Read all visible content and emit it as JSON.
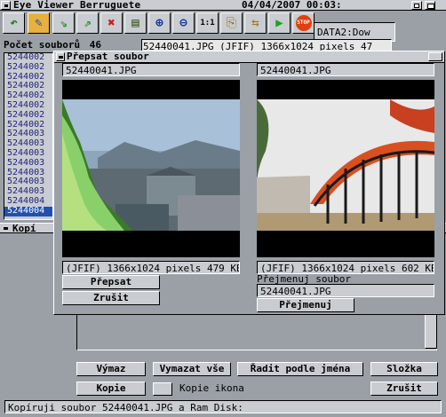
{
  "window": {
    "title": "Eye Viewer Berruguete",
    "datetime": "04/04/2007 00:03:"
  },
  "toolbar": {
    "buttons": [
      {
        "name": "back-icon",
        "glyph": "↶"
      },
      {
        "name": "image-edit-icon",
        "glyph": "✎"
      },
      {
        "name": "arrow-down-icon",
        "glyph": "⇘"
      },
      {
        "name": "arrow-right-icon",
        "glyph": "⇗"
      },
      {
        "name": "delete-icon",
        "glyph": "✖"
      },
      {
        "name": "info-icon",
        "glyph": "▤"
      },
      {
        "name": "zoom-in-icon",
        "glyph": "⊕"
      },
      {
        "name": "zoom-out-icon",
        "glyph": "⊖"
      },
      {
        "name": "actual-size-icon",
        "glyph": "1:1"
      },
      {
        "name": "copy-icon",
        "glyph": "⎘"
      },
      {
        "name": "move-icon",
        "glyph": "⇆"
      },
      {
        "name": "play-icon",
        "glyph": "▶"
      },
      {
        "name": "stop-icon",
        "glyph": "STOP"
      }
    ],
    "drive_field": "DATA2:Dow"
  },
  "left_panel": {
    "count_label": "Počet souborů",
    "count_value": "46",
    "files": [
      "5244002",
      "5244002",
      "5244002",
      "5244002",
      "5244002",
      "5244002",
      "5244002",
      "5244002",
      "5244003",
      "5244003",
      "5244003",
      "5244003",
      "5244003",
      "5244003",
      "5244003",
      "5244004",
      "5244004"
    ],
    "selected_index": 16
  },
  "info_strip": "52440041.JPG (JFIF) 1366x1024 pixels 47",
  "dialog": {
    "title": "Přepsat soubor",
    "left_filename": "52440041.JPG",
    "right_filename": "52440041.JPG",
    "left_info": "(JFIF) 1366x1024 pixels 479 KB",
    "right_info": "(JFIF) 1366x1024 pixels 602 KB",
    "overwrite_button": "Přepsat",
    "cancel_button": "Zrušit",
    "rename_label": "Přejmenuj soubor",
    "rename_value": "52440041.JPG",
    "rename_button": "Přejmenuj"
  },
  "copy_window": {
    "title": "Kopí",
    "buttons": {
      "clear": "Výmaz",
      "clear_all": "Vymazat vše",
      "sort_by_name": "Řadit podle jména",
      "folder": "Složka",
      "copy": "Kopie",
      "copy_icon": "Kopie ikona",
      "cancel": "Zrušit"
    },
    "status": "Kopíruji soubor 52440041.JPG a Ram Disk:"
  }
}
